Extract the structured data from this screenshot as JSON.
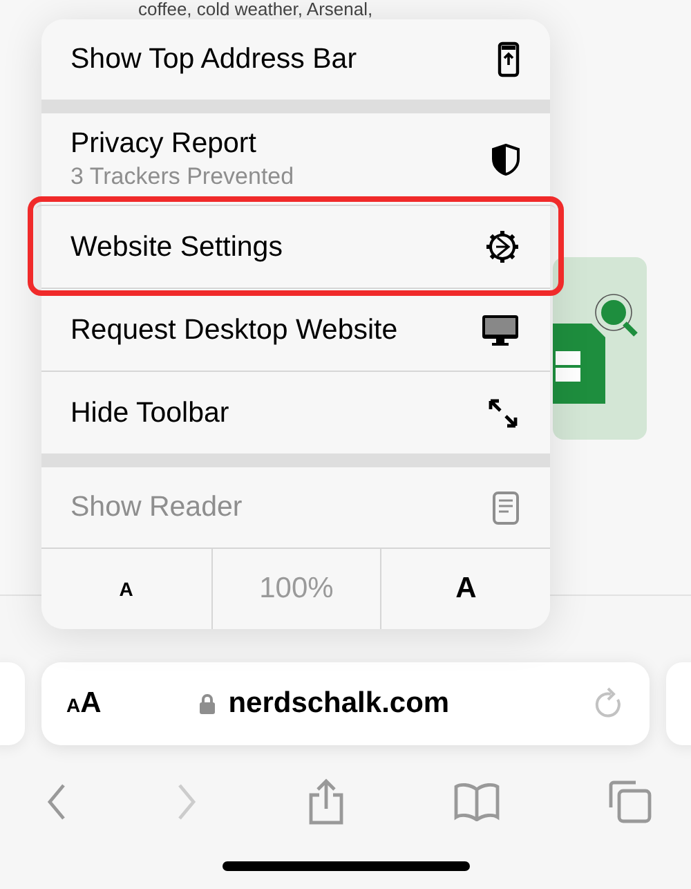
{
  "page_text": "coffee, cold weather, Arsenal,",
  "menu": {
    "sections": [
      {
        "items": [
          {
            "label": "Show Top Address Bar",
            "disabled": false,
            "annotated": false
          }
        ]
      },
      {
        "items": [
          {
            "label": "Privacy Report",
            "subtitle": "3 Trackers Prevented",
            "disabled": false,
            "annotated": false
          },
          {
            "label": "Website Settings",
            "disabled": false,
            "annotated": true
          },
          {
            "label": "Request Desktop Website",
            "disabled": false,
            "annotated": false
          },
          {
            "label": "Hide Toolbar",
            "disabled": false,
            "annotated": false
          }
        ]
      },
      {
        "items": [
          {
            "label": "Show Reader",
            "disabled": true,
            "annotated": false
          }
        ]
      }
    ],
    "zoom_row": {
      "decrease": "A",
      "level": "100%",
      "increase": "A"
    }
  },
  "address_bar": {
    "format_button": "AA",
    "url": "nerdschalk.com"
  }
}
